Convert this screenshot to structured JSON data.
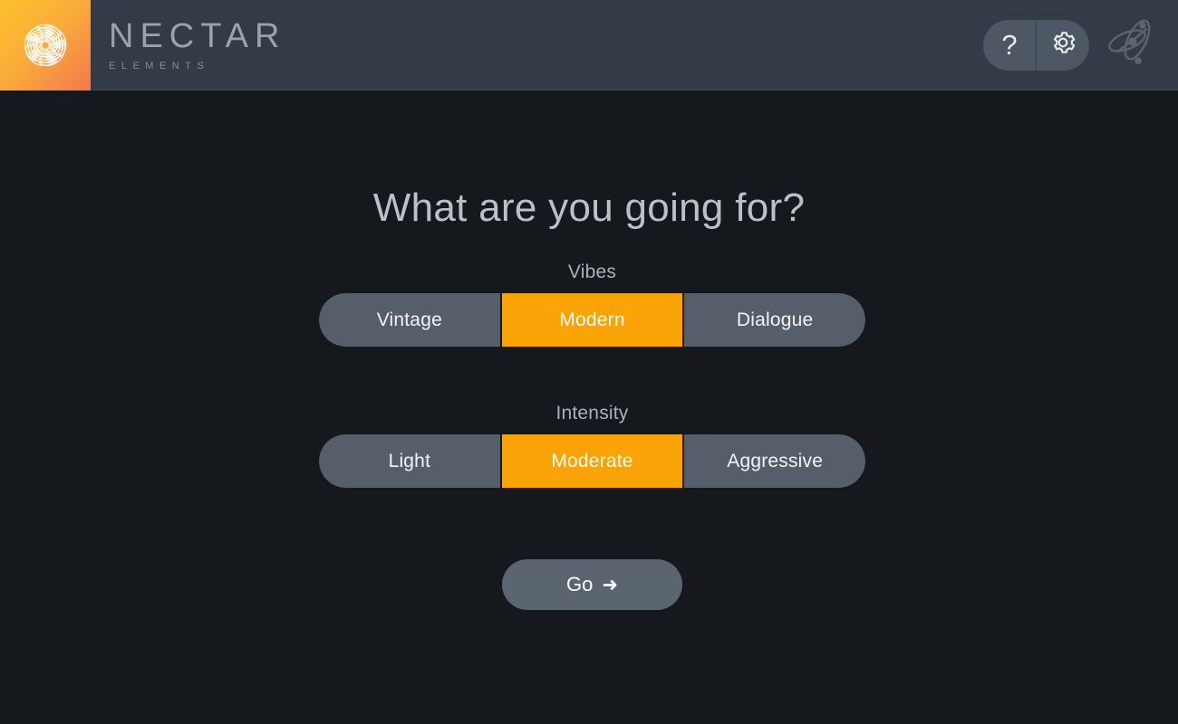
{
  "header": {
    "brand_name": "NECTAR",
    "brand_subtitle": "ELEMENTS",
    "logo_icon": "nectar-flower-spiral-logo",
    "help_label": "?",
    "help_icon": "question-mark-icon",
    "settings_icon": "gear-icon",
    "decorative_mark_icon": "orbital-scribble-mark-icon",
    "colors": {
      "bar": "#333b46",
      "logo_gradient_start": "#fbc02d",
      "logo_gradient_end": "#f2794f",
      "pill": "#4e5864"
    }
  },
  "main": {
    "title": "What are you going for?",
    "groups": [
      {
        "label": "Vibes",
        "options": [
          {
            "label": "Vintage",
            "selected": false
          },
          {
            "label": "Modern",
            "selected": true
          },
          {
            "label": "Dialogue",
            "selected": false
          }
        ]
      },
      {
        "label": "Intensity",
        "options": [
          {
            "label": "Light",
            "selected": false
          },
          {
            "label": "Moderate",
            "selected": true
          },
          {
            "label": "Aggressive",
            "selected": false
          }
        ]
      }
    ],
    "go_button": {
      "label": "Go",
      "arrow_glyph": "➜",
      "arrow_icon": "arrow-right-icon"
    },
    "colors": {
      "background": "#15181d",
      "selected_accent": "#faa307",
      "unselected_segment": "#565f69",
      "title_text": "#b9c0c7",
      "label_text": "#aab1b9"
    }
  }
}
